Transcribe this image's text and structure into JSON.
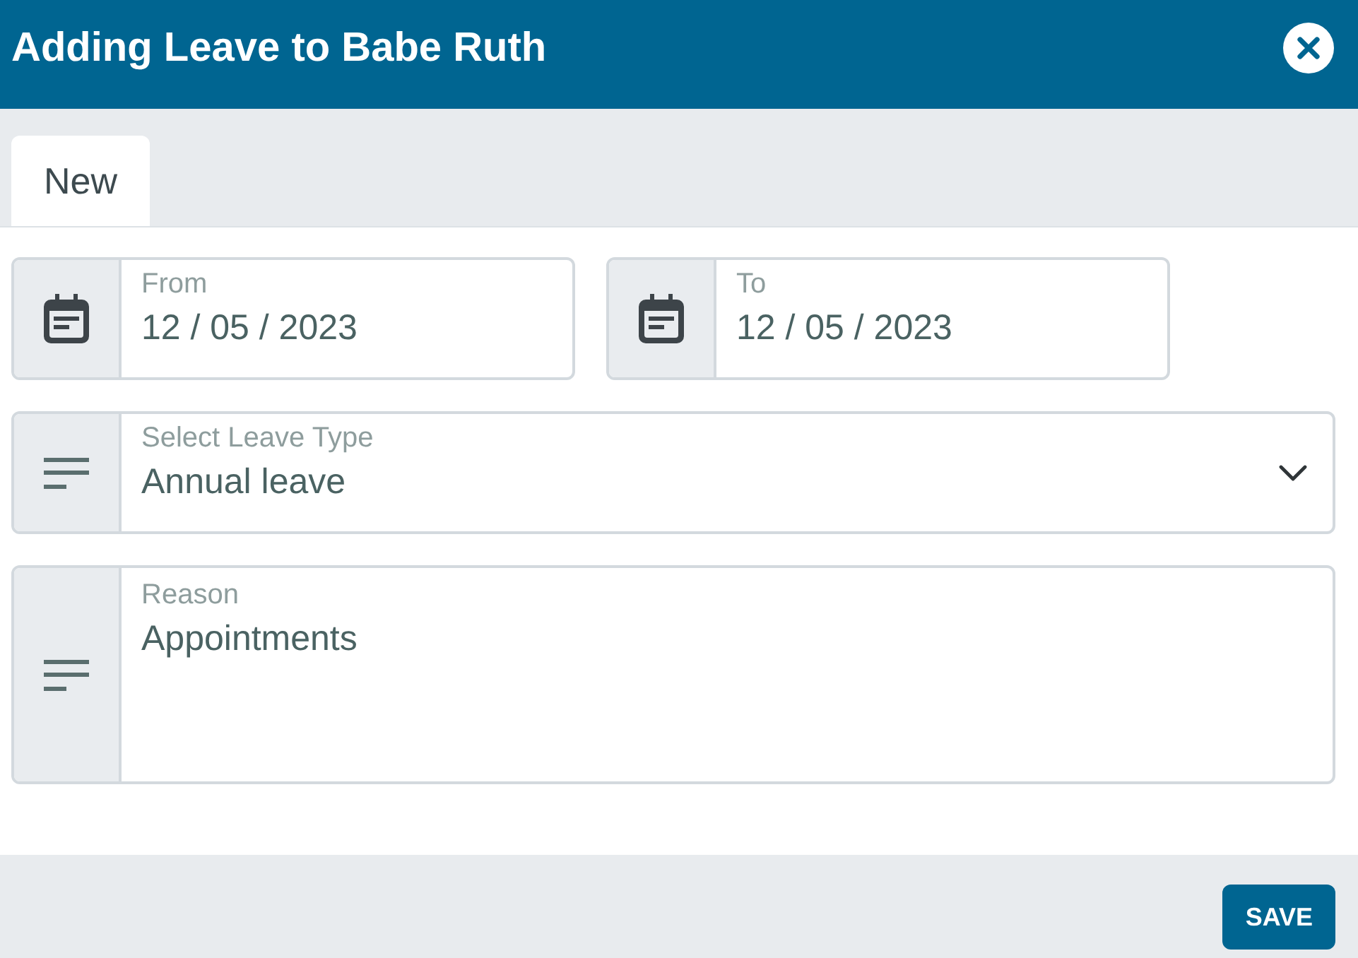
{
  "dialog": {
    "title": "Adding Leave to Babe Ruth"
  },
  "tabs": [
    {
      "label": "New",
      "selected": true
    }
  ],
  "rows": [
    {
      "fields": [
        {
          "kind": "date",
          "label": "From",
          "value": "12 / 05 / 2023"
        },
        {
          "kind": "date",
          "label": "To",
          "value": "12 / 05 / 2023"
        }
      ]
    },
    {
      "fields": [
        {
          "kind": "select",
          "label": "Select Leave Type",
          "value": "Annual leave"
        }
      ]
    },
    {
      "fields": [
        {
          "kind": "textarea",
          "label": "Reason",
          "value": "Appointments"
        }
      ]
    }
  ],
  "buttons": [
    {
      "label": "SAVE"
    }
  ]
}
